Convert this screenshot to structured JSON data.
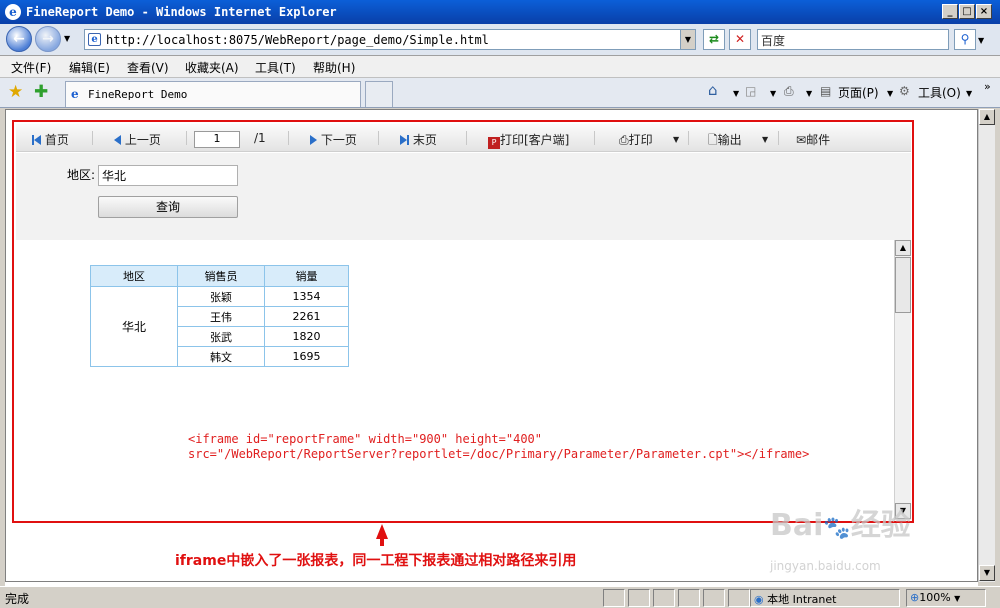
{
  "window": {
    "title": "FineReport Demo - Windows Internet Explorer"
  },
  "address_bar": {
    "url": "http://localhost:8075/WebReport/page_demo/Simple.html"
  },
  "search_box": {
    "placeholder": "百度"
  },
  "menu": [
    "文件(F)",
    "编辑(E)",
    "查看(V)",
    "收藏夹(A)",
    "工具(T)",
    "帮助(H)"
  ],
  "tab": {
    "title": "FineReport Demo"
  },
  "command_bar": {
    "page": "页面(P)",
    "tools": "工具(O)"
  },
  "report_toolbar": {
    "first": "首页",
    "prev": "上一页",
    "page_value": "1",
    "page_total": "/1",
    "next": "下一页",
    "last": "末页",
    "print_client": "打印[客户端]",
    "print": "打印",
    "export": "输出",
    "mail": "邮件"
  },
  "params": {
    "region_label": "地区:",
    "region_value": "华北",
    "query_button": "查询"
  },
  "report_table": {
    "headers": [
      "地区",
      "销售员",
      "销量"
    ],
    "region": "华北",
    "rows": [
      {
        "seller": "张颖",
        "sales": "1354"
      },
      {
        "seller": "王伟",
        "sales": "2261"
      },
      {
        "seller": "张武",
        "sales": "1820"
      },
      {
        "seller": "韩文",
        "sales": "1695"
      }
    ]
  },
  "code_annotation": [
    "<iframe id=\"reportFrame\" width=\"900\" height=\"400\"",
    "src=\"/WebReport/ReportServer?reportlet=/doc/Primary/Parameter/Parameter.cpt\"></iframe>"
  ],
  "annotation": "iframe中嵌入了一张报表，同一工程下报表通过相对路径来引用",
  "status_bar": {
    "text": "完成",
    "zone": "本地 Intranet",
    "zoom": "100%"
  },
  "watermark": {
    "brand": "Bai",
    "brand_cn": "经验",
    "url": "jingyan.baidu.com"
  },
  "colors": {
    "annotation_red": "#e01010",
    "table_border": "#8cc4ea",
    "table_header": "#d8ecfa"
  }
}
